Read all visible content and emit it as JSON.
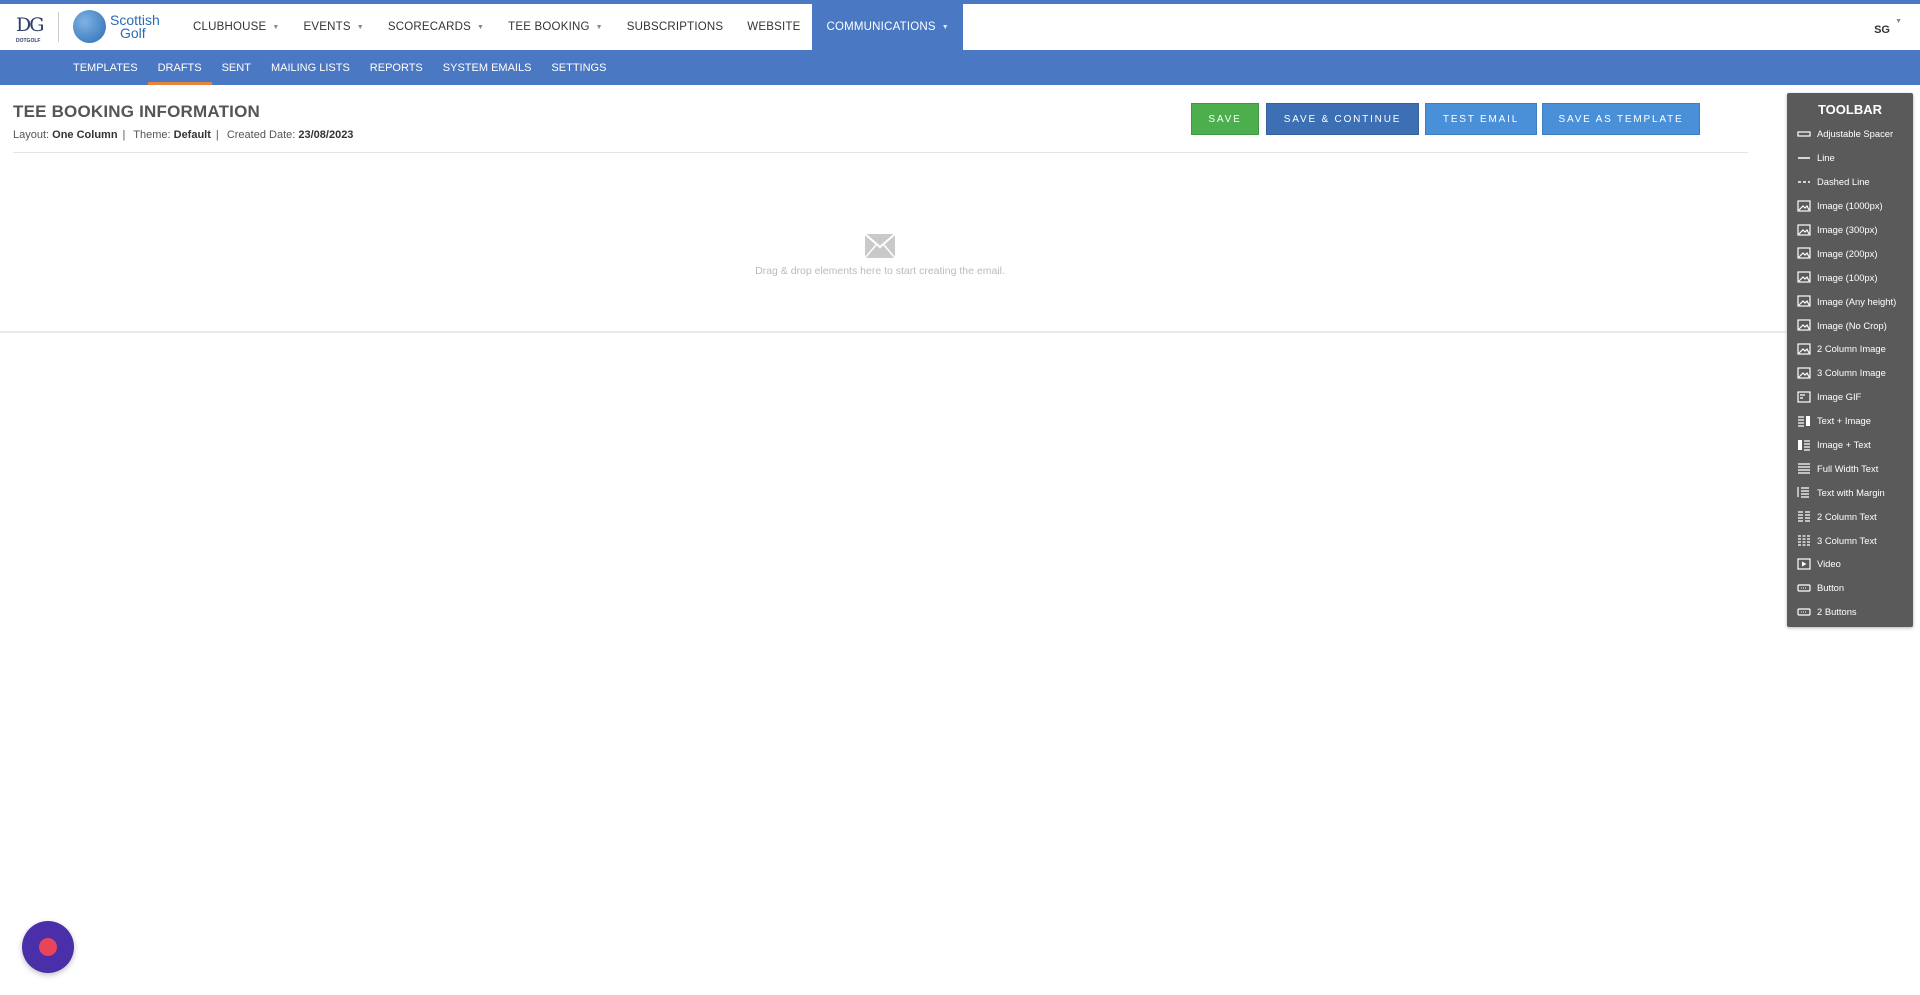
{
  "brand": {
    "dg_logo": "DG",
    "dg_sub": "DOTGOLF",
    "sg_line1": "Scottish",
    "sg_line2": "Golf"
  },
  "main_nav": [
    {
      "label": "CLUBHOUSE",
      "dropdown": true
    },
    {
      "label": "EVENTS",
      "dropdown": true
    },
    {
      "label": "SCORECARDS",
      "dropdown": true
    },
    {
      "label": "TEE BOOKING",
      "dropdown": true
    },
    {
      "label": "SUBSCRIPTIONS",
      "dropdown": false
    },
    {
      "label": "WEBSITE",
      "dropdown": false
    },
    {
      "label": "COMMUNICATIONS",
      "dropdown": true,
      "active": true
    }
  ],
  "user": {
    "initials": "SG"
  },
  "sub_nav": [
    {
      "label": "TEMPLATES"
    },
    {
      "label": "DRAFTS",
      "active": true
    },
    {
      "label": "SENT"
    },
    {
      "label": "MAILING LISTS"
    },
    {
      "label": "REPORTS"
    },
    {
      "label": "SYSTEM EMAILS"
    },
    {
      "label": "SETTINGS"
    }
  ],
  "email": {
    "title": "TEE BOOKING INFORMATION",
    "layout_label": "Layout:",
    "layout": "One Column",
    "theme_label": "Theme:",
    "theme": "Default",
    "created_label": "Created Date:",
    "created": "23/08/2023"
  },
  "actions": {
    "save": "SAVE",
    "save_continue": "SAVE & CONTINUE",
    "test_email": "TEST EMAIL",
    "save_template": "SAVE AS TEMPLATE"
  },
  "dropzone": {
    "text": "Drag & drop elements here to start creating the email."
  },
  "toolbar": {
    "title": "TOOLBAR",
    "items": [
      {
        "label": "Adjustable Spacer",
        "icon": "spacer"
      },
      {
        "label": "Line",
        "icon": "line"
      },
      {
        "label": "Dashed Line",
        "icon": "dashed"
      },
      {
        "label": "Image (1000px)",
        "icon": "image"
      },
      {
        "label": "Image (300px)",
        "icon": "image"
      },
      {
        "label": "Image (200px)",
        "icon": "image"
      },
      {
        "label": "Image (100px)",
        "icon": "image"
      },
      {
        "label": "Image (Any height)",
        "icon": "image"
      },
      {
        "label": "Image (No Crop)",
        "icon": "image"
      },
      {
        "label": "2 Column Image",
        "icon": "image"
      },
      {
        "label": "3 Column Image",
        "icon": "image"
      },
      {
        "label": "Image GIF",
        "icon": "gif"
      },
      {
        "label": "Text + Image",
        "icon": "text-image"
      },
      {
        "label": "Image + Text",
        "icon": "image-text"
      },
      {
        "label": "Full Width Text",
        "icon": "fulltext"
      },
      {
        "label": "Text with Margin",
        "icon": "margintext"
      },
      {
        "label": "2 Column Text",
        "icon": "text2"
      },
      {
        "label": "3 Column Text",
        "icon": "text3"
      },
      {
        "label": "Video",
        "icon": "video"
      },
      {
        "label": "Button",
        "icon": "button"
      },
      {
        "label": "2 Buttons",
        "icon": "button"
      }
    ]
  }
}
